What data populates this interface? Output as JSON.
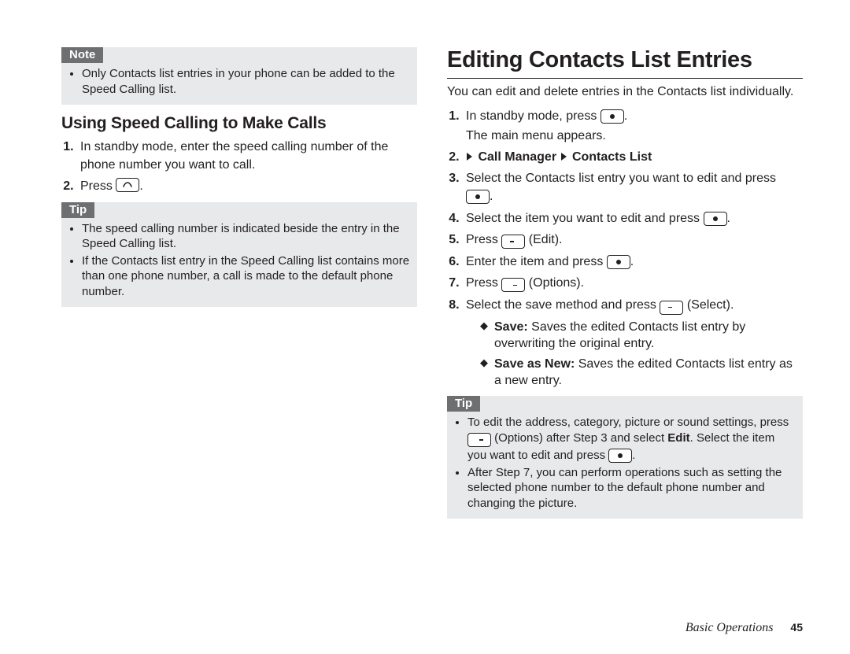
{
  "left": {
    "note": {
      "label": "Note",
      "items": [
        "Only Contacts list entries in your phone can be added to the Speed Calling list."
      ]
    },
    "subhead": "Using Speed Calling to Make Calls",
    "steps": [
      "In standby mode, enter the speed calling number of the phone number you want to call.",
      "Press "
    ],
    "tip": {
      "label": "Tip",
      "items": [
        "The speed calling number is indicated beside the entry in the Speed Calling list.",
        "If the Contacts list entry in the Speed Calling list contains more than one phone number, a call is made to the default phone number."
      ]
    }
  },
  "right": {
    "heading": "Editing Contacts List Entries",
    "intro": "You can edit and delete entries in the Contacts list individually.",
    "step1a": "In standby mode, press ",
    "step1b": "The main menu appears.",
    "step2_a": "Call Manager",
    "step2_b": "Contacts List",
    "step3": "Select the Contacts list entry you want to edit and press ",
    "step4": "Select the item you want to edit and press ",
    "step5a": "Press ",
    "step5b": " (Edit).",
    "step6": "Enter the item and press ",
    "step7a": "Press ",
    "step7b": " (Options).",
    "step8a": "Select the save method and press ",
    "step8b": " (Select).",
    "save_label": "Save:",
    "save_text": " Saves the edited Contacts list entry by overwriting the original entry.",
    "savenew_label": "Save as New:",
    "savenew_text": " Saves the edited Contacts list entry as a new entry.",
    "tip": {
      "label": "Tip",
      "item1a": "To edit the address, category, picture or sound settings, press ",
      "item1b": " (Options) after Step 3 and select ",
      "item1_bold": "Edit",
      "item1c": ". Select the item you want to edit and press ",
      "item2": "After Step 7, you can perform operations such as setting the selected phone number to the default phone number and changing the picture."
    }
  },
  "footer": {
    "section": "Basic Operations",
    "page": "45"
  }
}
